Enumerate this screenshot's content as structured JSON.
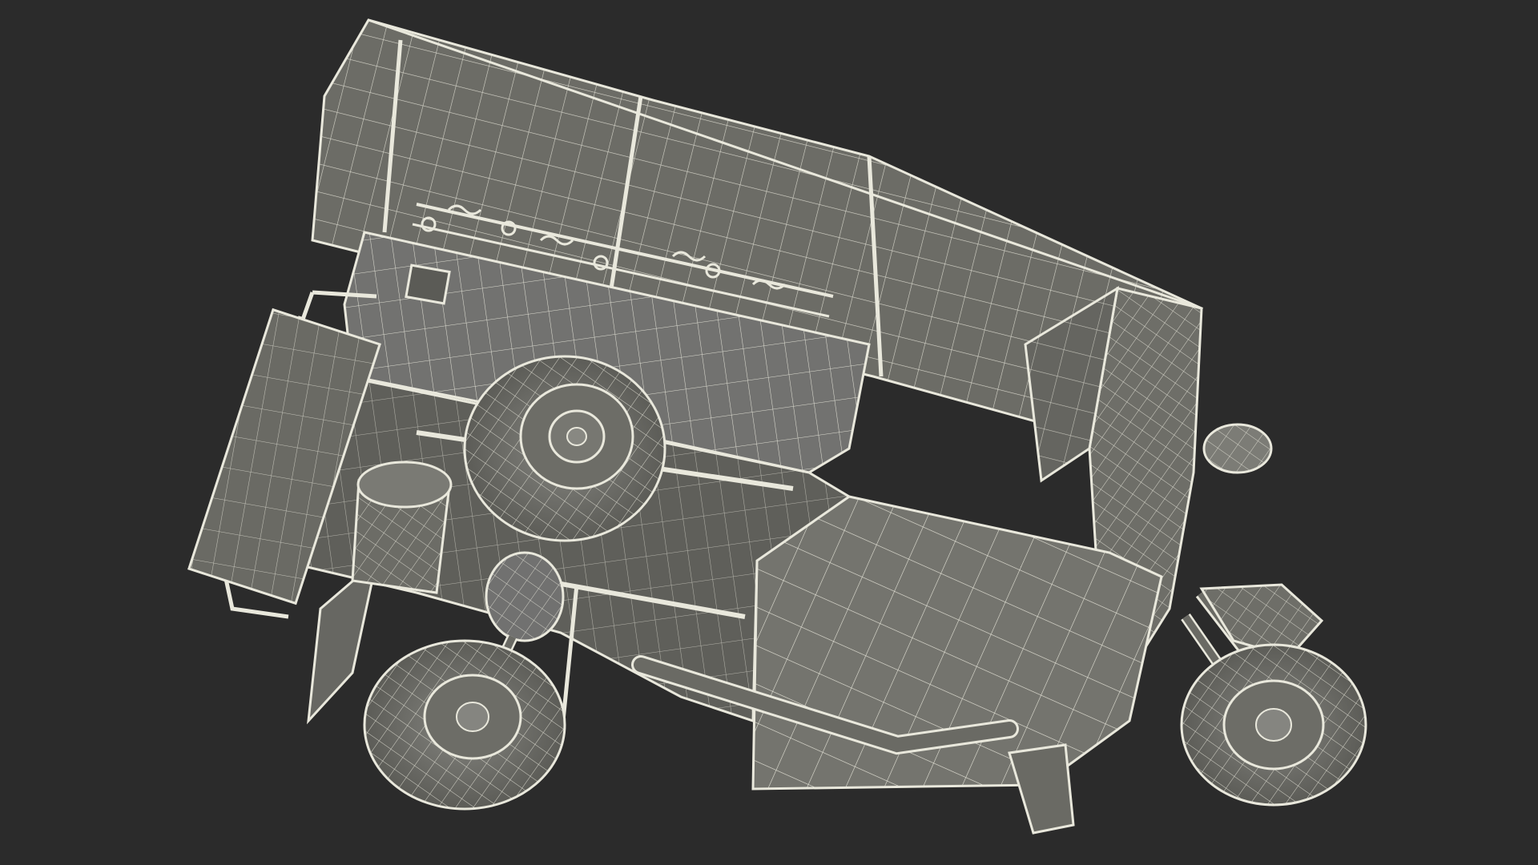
{
  "viewport": {
    "background": "#2b2b2b",
    "surface_fill": "#6f6f69",
    "surface_fill_dark": "#5b5b56",
    "surface_fill_light": "#7f7f78",
    "wire_color": "#e9e8dc",
    "subject": "wireframe-auto-rickshaw-model"
  }
}
